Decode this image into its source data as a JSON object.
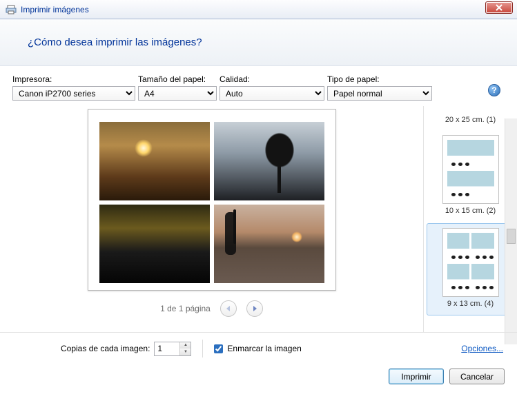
{
  "window": {
    "title": "Imprimir imágenes"
  },
  "header": {
    "question": "¿Cómo desea imprimir las imágenes?"
  },
  "labels": {
    "printer": "Impresora:",
    "paperSize": "Tamaño del papel:",
    "quality": "Calidad:",
    "paperType": "Tipo de papel:"
  },
  "values": {
    "printer": "Canon iP2700 series",
    "paperSize": "A4",
    "quality": "Auto",
    "paperType": "Papel normal"
  },
  "pager": {
    "text": "1 de 1 página"
  },
  "layouts": {
    "cutoff": "20 x 25 cm. (1)",
    "a": "10 x 15 cm. (2)",
    "b": "9 x 13 cm. (4)"
  },
  "bottom": {
    "copiesLabel": "Copias de cada imagen:",
    "copiesValue": "1",
    "frameLabel": "Enmarcar la imagen",
    "options": "Opciones..."
  },
  "buttons": {
    "print": "Imprimir",
    "cancel": "Cancelar"
  },
  "icons": {
    "help": "?"
  }
}
